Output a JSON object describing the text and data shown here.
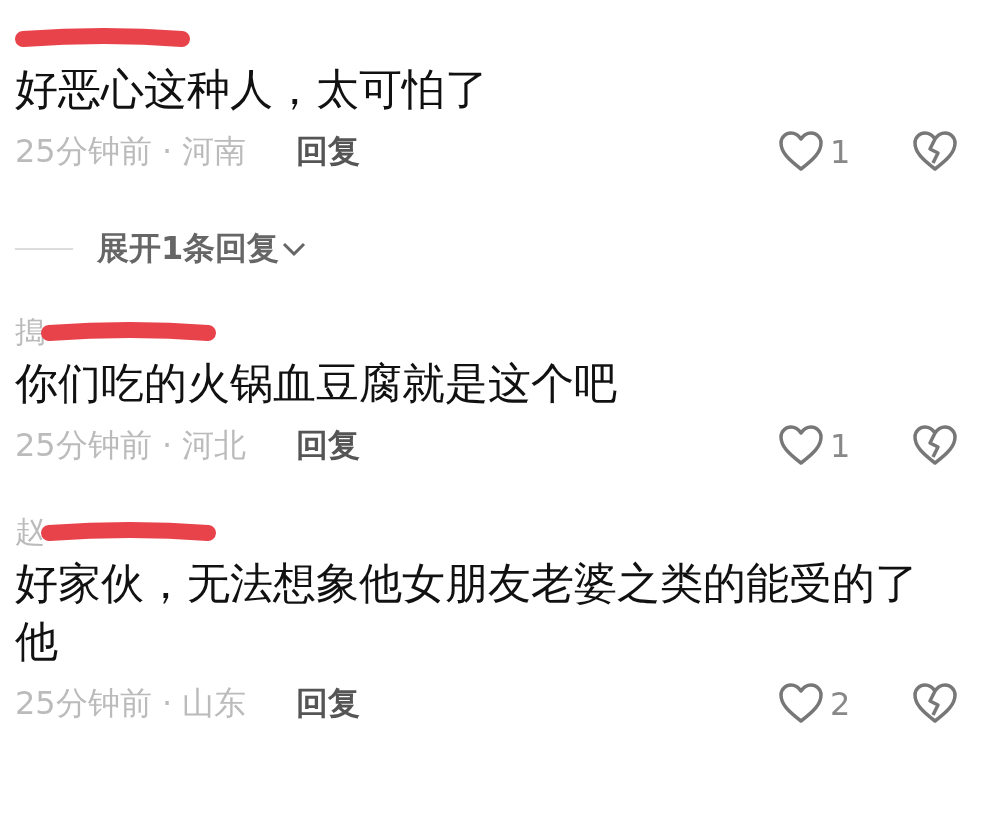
{
  "comments": [
    {
      "text": "好恶心这种人，太可怕了",
      "meta": "25分钟前 · 河南",
      "reply": "回复",
      "likes": "1",
      "expand": {
        "label": "展开1条回复"
      }
    },
    {
      "username": "搗",
      "text": "你们吃的火锅血豆腐就是这个吧",
      "meta": "25分钟前 · 河北",
      "reply": "回复",
      "likes": "1"
    },
    {
      "username": "赵",
      "text": "好家伙，无法想象他女朋友老婆之类的能受的了他",
      "meta": "25分钟前 · 山东",
      "reply": "回复",
      "likes": "2"
    }
  ]
}
